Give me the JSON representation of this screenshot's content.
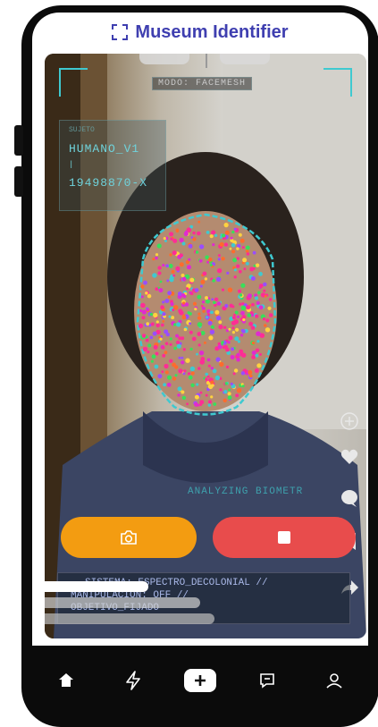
{
  "header": {
    "title": "Museum Identifier",
    "icon": "scan-frame-icon",
    "title_color": "#3f3fb0"
  },
  "camera": {
    "mode_label": "MODO: FACEMESH",
    "id_panel": {
      "small_label": "SUJETO",
      "name": "HUMANO_V1",
      "separator": "|",
      "code": "19498870-X"
    },
    "analyzing_text": "ANALYZING BIOMETR",
    "mesh_color": "#3fc9d0"
  },
  "side_actions": [
    "plus-circle-icon",
    "heart-icon",
    "comment-icon",
    "bookmark-icon",
    "share-icon"
  ],
  "controls": {
    "capture_icon": "camera-icon",
    "capture_color": "#f39c11",
    "stop_icon": "stop-icon",
    "stop_color": "#e84c4c"
  },
  "status": {
    "line1": "SISTEMA: ESPECTRO_DECOLONIAL //",
    "line2": "MANIPULACIÓN: OFF //",
    "line3": "OBJETIVO_FIJADO"
  },
  "bottom_nav": [
    {
      "name": "home",
      "icon": "home-icon"
    },
    {
      "name": "flash",
      "icon": "lightning-icon"
    },
    {
      "name": "create",
      "icon": "plus-icon"
    },
    {
      "name": "messages",
      "icon": "message-icon"
    },
    {
      "name": "profile",
      "icon": "user-icon"
    }
  ]
}
